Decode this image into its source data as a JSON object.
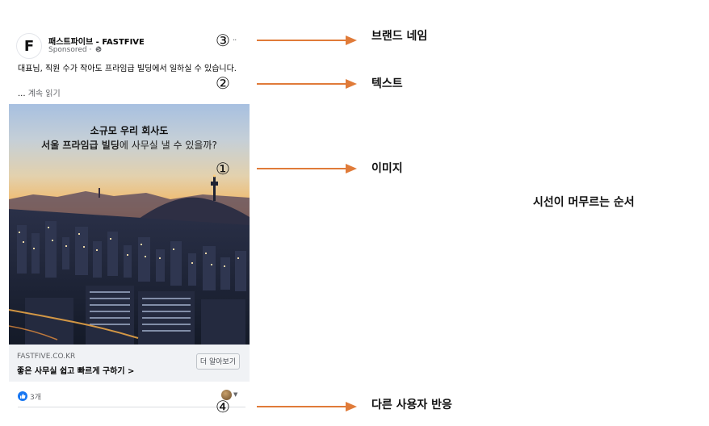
{
  "post": {
    "logo_letter": "F",
    "page_name": "패스트파이브 - FASTFIVE",
    "sponsored": "Sponsored · ",
    "more_label": "··",
    "body_text": "대표님, 직원 수가 작아도 프라임급 빌딩에서 일하실 수 있습니다.",
    "see_more_dots": "...",
    "see_more": " 계속 읽기",
    "image": {
      "headline_line1": "소규모 우리 회사도",
      "headline_line2_bold": "서울 프라임급 빌딩",
      "headline_line2_rest": "에 사무실 낼 수 있을까?"
    },
    "cta": {
      "domain": "FASTFIVE.CO.KR",
      "title": "좋은 사무실 쉽고 빠르게 구하기 >",
      "button": "더 알아보기"
    },
    "reactions": {
      "count": "3개"
    }
  },
  "markers": [
    "①",
    "②",
    "③",
    "④"
  ],
  "annotations": {
    "brand_name": "브랜드 네임",
    "text": "텍스트",
    "image": "이미지",
    "reactions": "다른 사용자 반응",
    "gaze_order": "시선이 머무르는 순서"
  },
  "colors": {
    "arrow": "#e07b39",
    "facebook_blue": "#1877f2"
  }
}
